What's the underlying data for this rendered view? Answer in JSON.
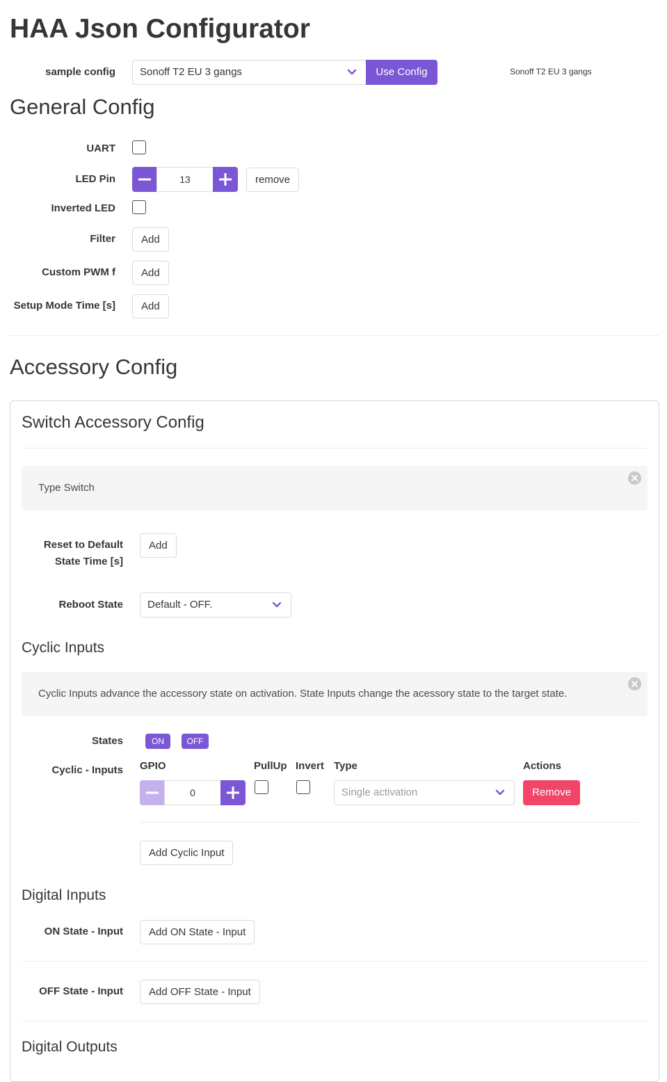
{
  "title": "HAA Json Configurator",
  "sample_config": {
    "label": "sample config",
    "selected": "Sonoff T2 EU 3 gangs",
    "use_button": "Use Config",
    "current_name": "Sonoff T2 EU 3 gangs"
  },
  "general": {
    "heading": "General Config",
    "uart_label": "UART",
    "led_pin_label": "LED Pin",
    "led_pin_value": "13",
    "remove_label": "remove",
    "inverted_led_label": "Inverted LED",
    "filter_label": "Filter",
    "custom_pwm_label": "Custom PWM f",
    "setup_mode_label": "Setup Mode Time [s]",
    "add_label": "Add"
  },
  "accessory": {
    "heading": "Accessory Config",
    "card_title": "Switch Accessory Config",
    "type_notice": "Type Switch",
    "reset_label_line1": "Reset to Default",
    "reset_label_line2": "State Time [s]",
    "reset_add": "Add",
    "reboot_label": "Reboot State",
    "reboot_selected": "Default - OFF.",
    "cyclic": {
      "heading": "Cyclic Inputs",
      "notice": "Cyclic Inputs advance the accessory state on activation. State Inputs change the acessory state to the target state.",
      "states_label": "States",
      "states": [
        "ON",
        "OFF"
      ],
      "inputs_label": "Cyclic - Inputs",
      "columns": {
        "gpio": "GPIO",
        "pullup": "PullUp",
        "invert": "Invert",
        "type": "Type",
        "actions": "Actions"
      },
      "row": {
        "gpio": "0",
        "type": "Single activation",
        "remove": "Remove"
      },
      "add_button": "Add Cyclic Input"
    },
    "digital_inputs": {
      "heading": "Digital Inputs",
      "on_label": "ON State - Input",
      "on_button": "Add ON State - Input",
      "off_label": "OFF State - Input",
      "off_button": "Add OFF State - Input"
    },
    "digital_outputs": {
      "heading": "Digital Outputs"
    }
  },
  "colors": {
    "accent": "#7b57d6",
    "accent_disabled": "#c3b2ec",
    "danger": "#f14668",
    "notice_bg": "#f5f5f5"
  }
}
